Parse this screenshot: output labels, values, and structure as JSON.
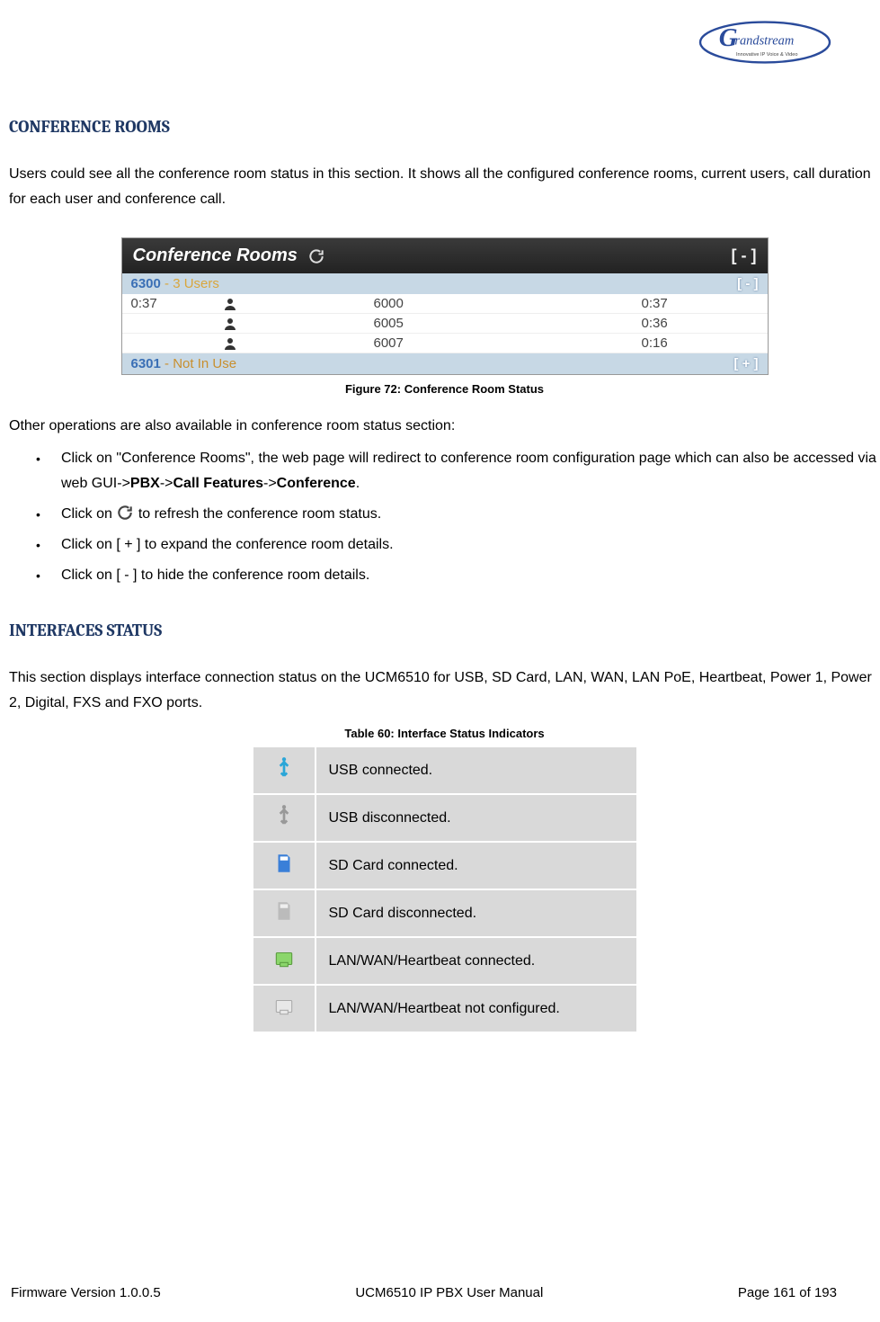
{
  "logo": {
    "brand": "Grandstream",
    "tagline": "Innovative IP Voice & Video"
  },
  "section1": {
    "title": "CONFERENCE ROOMS",
    "intro": "Users could see all the conference room status in this section. It shows all the configured conference rooms, current users, call duration for each user and conference call."
  },
  "widget": {
    "title": "Conference Rooms",
    "collapse": "[ - ]",
    "room1": {
      "id": "6300",
      "sep": "-",
      "users_label": "3 Users",
      "collapse": "[ - ]"
    },
    "row_duration": "0:37",
    "rows": [
      {
        "ext": "6000",
        "dur": "0:37"
      },
      {
        "ext": "6005",
        "dur": "0:36"
      },
      {
        "ext": "6007",
        "dur": "0:16"
      }
    ],
    "room2": {
      "id": "6301",
      "sep": "-",
      "status": "Not In Use",
      "expand": "[ + ]"
    }
  },
  "figure_caption": "Figure 72: Conference Room Status",
  "ops_intro": "Other operations are also available in conference room status section:",
  "bullets": {
    "b1a": "Click on \"Conference Rooms\", the web page will redirect to conference room configuration page which can also be accessed via web GUI->",
    "b1_pbx": "PBX",
    "b1_sep1": "->",
    "b1_cf": "Call Features",
    "b1_sep2": "->",
    "b1_conf": "Conference",
    "b1_end": ".",
    "b2a": "Click on ",
    "b2b": " to refresh the conference room status.",
    "b3": "Click on [ + ] to expand the conference room details.",
    "b4": "Click on [ - ]   to hide the conference room details."
  },
  "section2": {
    "title": "INTERFACES STATUS",
    "intro": "This section displays interface connection status on the UCM6510 for USB, SD Card, LAN, WAN, LAN PoE, Heartbeat, Power 1, Power 2, Digital, FXS and FXO ports."
  },
  "table_caption": "Table 60: Interface Status Indicators",
  "table_rows": [
    {
      "icon": "usb-on",
      "label": "USB connected."
    },
    {
      "icon": "usb-off",
      "label": "USB disconnected."
    },
    {
      "icon": "sd-on",
      "label": "SD Card connected."
    },
    {
      "icon": "sd-off",
      "label": "SD Card disconnected."
    },
    {
      "icon": "lan-on",
      "label": "LAN/WAN/Heartbeat connected."
    },
    {
      "icon": "lan-off",
      "label": "LAN/WAN/Heartbeat not configured."
    }
  ],
  "footer": {
    "left": "Firmware Version 1.0.0.5",
    "center": "UCM6510 IP PBX User Manual",
    "right": "Page 161 of 193"
  }
}
